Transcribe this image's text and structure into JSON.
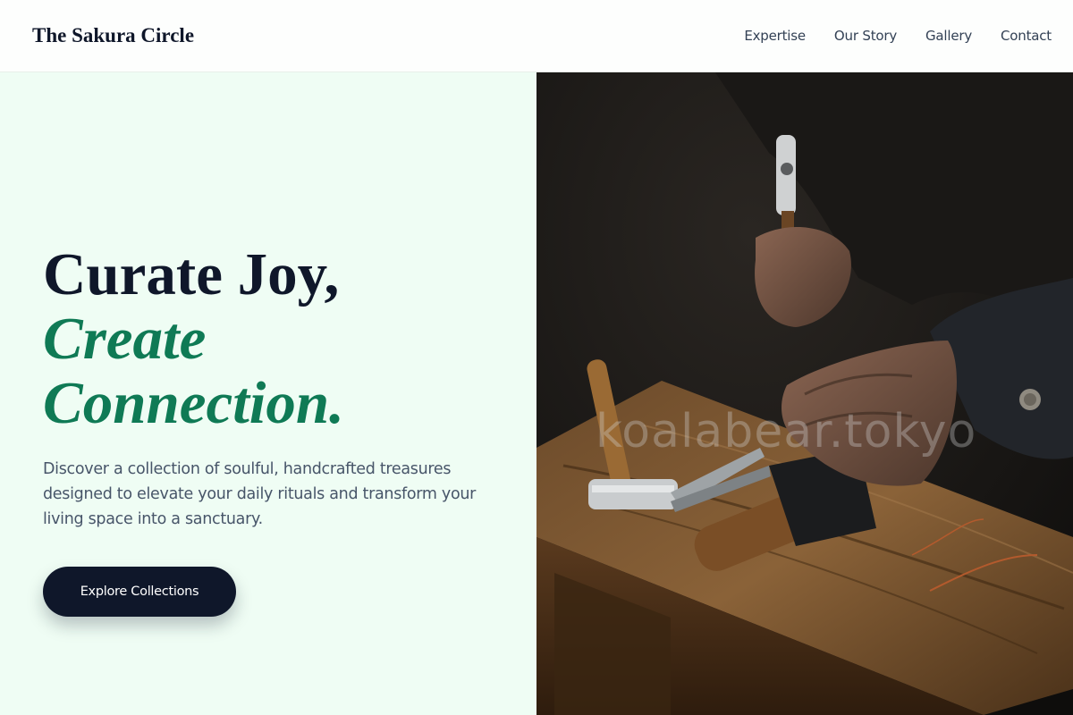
{
  "header": {
    "brand": "The Sakura Circle",
    "nav": [
      "Expertise",
      "Our Story",
      "Gallery",
      "Contact"
    ]
  },
  "hero": {
    "headline_line1": "Curate Joy,",
    "headline_line2": "Create",
    "headline_line3": "Connection.",
    "description": "Discover a collection of soulful, handcrafted treasures designed to elevate your daily rituals and transform your living space into a sanctuary.",
    "cta_label": "Explore Collections"
  },
  "image": {
    "watermark": "koalabear.tokyo",
    "subject": "craftsman-hands-with-hammer-and-tools-on-workbench"
  },
  "colors": {
    "left_bg": "#effdf4",
    "accent_green": "#0f7a55",
    "navy": "#0f172a"
  }
}
